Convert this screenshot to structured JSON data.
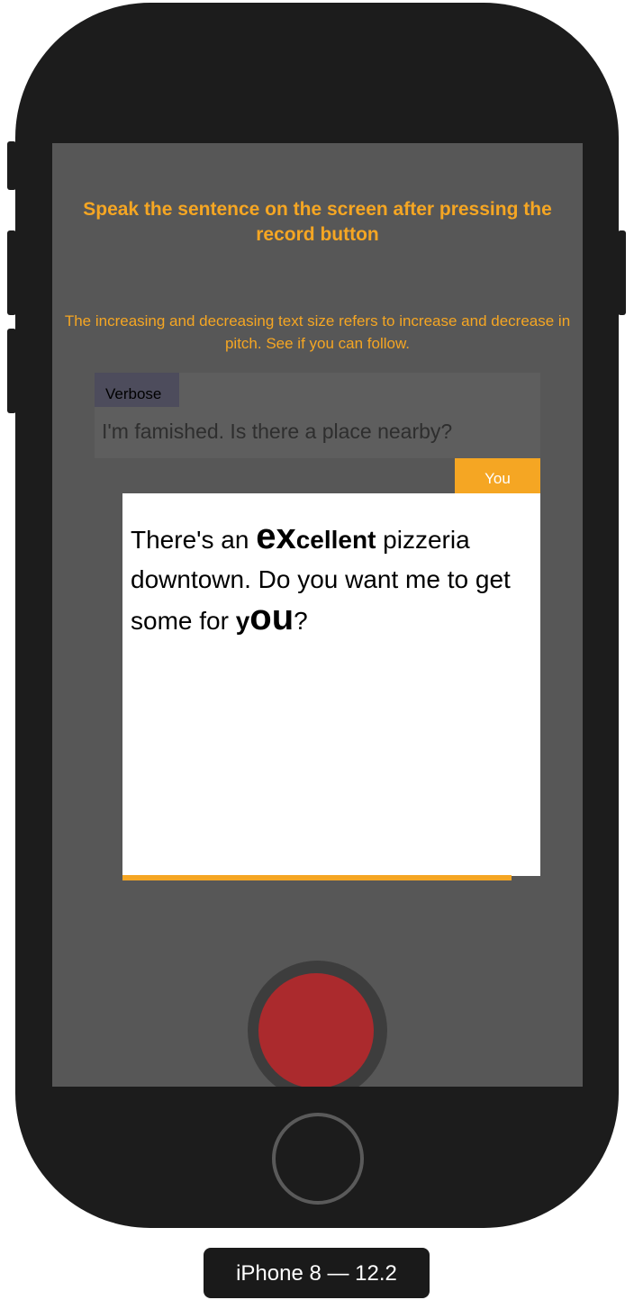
{
  "screen": {
    "title": "Speak the sentence on the screen after pressing the record button",
    "instructions": "The increasing and decreasing text size refers to increase and decrease in pitch. See if you can follow.",
    "verbose": {
      "tag_label": "Verbose",
      "sentence": "I'm famished. Is there a place nearby?"
    },
    "you": {
      "tag_label": "You",
      "sentence_parts": {
        "p1": "There's an ",
        "p2_big": "ex",
        "p3_bold": "cellent",
        "p4": " pizzeria downtown. Do you want me to get some for ",
        "p5_bold": "y",
        "p6_big": "ou",
        "p7": "?"
      },
      "progress": 0.93
    },
    "record_button_icon": "record-circle-icon"
  },
  "device_label": "iPhone 8 — 12.2",
  "colors": {
    "accent": "#f5a623",
    "screen_bg": "#575757",
    "record": "#ab2a2d",
    "card_bg": "#ffffff"
  }
}
